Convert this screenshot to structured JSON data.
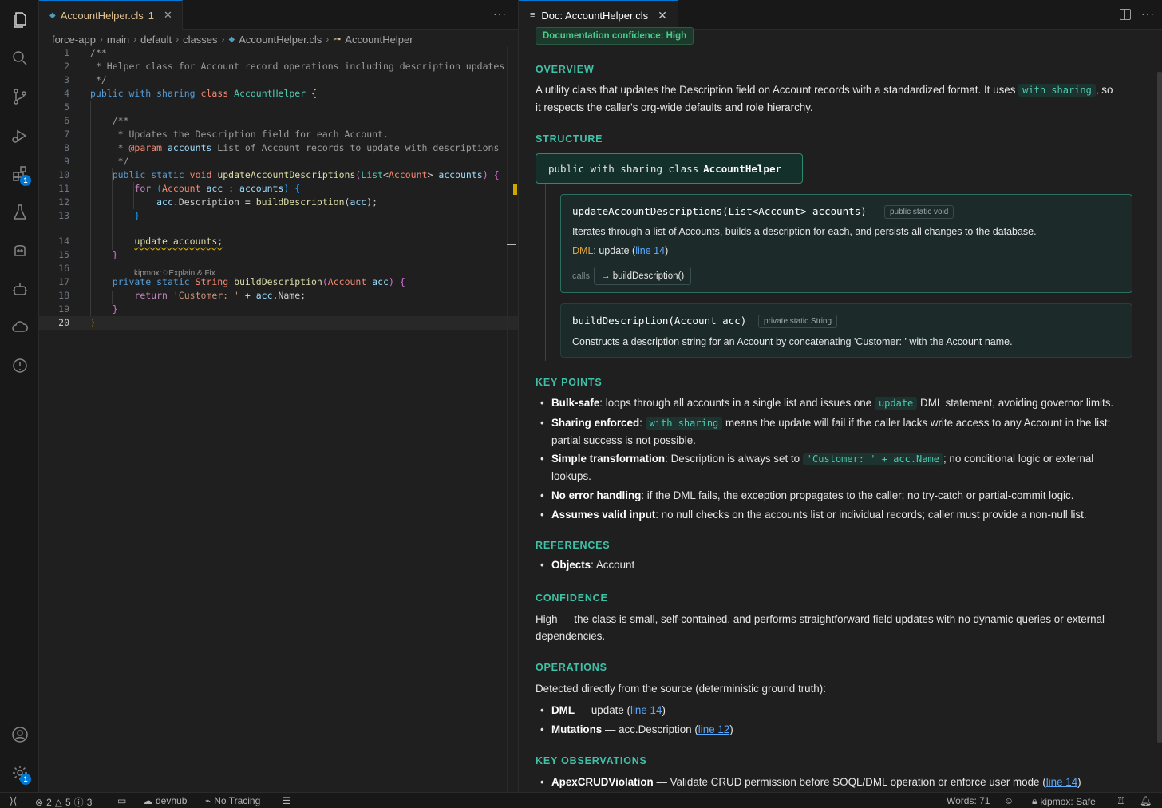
{
  "editor": {
    "tab": {
      "name": "AccountHelper.cls",
      "problems": "1"
    },
    "breadcrumb": [
      "force-app",
      "main",
      "default",
      "classes",
      "AccountHelper.cls",
      "AccountHelper"
    ],
    "lens_text": "kipmox:",
    "lens_action": "Explain & Fix",
    "line_numbers": [
      "1",
      "2",
      "3",
      "4",
      "5",
      "6",
      "7",
      "8",
      "9",
      "10",
      "11",
      "12",
      "13",
      "14",
      "15",
      "16",
      "17",
      "18",
      "19",
      "20"
    ]
  },
  "doc": {
    "tab_title": "Doc: AccountHelper.cls",
    "confidence_badge": "Documentation confidence: High",
    "overview": {
      "heading": "OVERVIEW",
      "text1": "A utility class that updates the Description field on Account records with a standardized format. It uses",
      "code": "with sharing",
      "text2": ", so",
      "text3": "it respects the caller's org-wide defaults and role hierarchy."
    },
    "structure": {
      "heading": "STRUCTURE",
      "class_prefix": "public with sharing class",
      "class_name": "AccountHelper",
      "methods": [
        {
          "signature": "updateAccountDescriptions(List<Account> accounts)",
          "tag": "public static void",
          "description": "Iterates through a list of Accounts, builds a description for each, and persists all changes to the database.",
          "dml_label": "DML",
          "dml_op": ": update (",
          "dml_link": "line 14",
          "dml_close": ")",
          "calls_label": "calls",
          "calls": "→ buildDescription()"
        },
        {
          "signature": "buildDescription(Account acc)",
          "tag": "private static String",
          "description": "Constructs a description string for an Account by concatenating 'Customer: ' with the Account name."
        }
      ]
    },
    "key_points": {
      "heading": "KEY POINTS",
      "items": [
        {
          "bold": "Bulk-safe",
          "pre": ": loops through all accounts in a single list and issues one ",
          "code": "update",
          "post": " DML statement, avoiding governor limits."
        },
        {
          "bold": "Sharing enforced",
          "pre": ": ",
          "code": "with sharing",
          "post": " means the update will fail if the caller lacks write access to any Account in the list; partial success is not possible."
        },
        {
          "bold": "Simple transformation",
          "pre": ": Description is always set to ",
          "code": "'Customer: ' + acc.Name",
          "post": "; no conditional logic or external lookups."
        },
        {
          "bold": "No error handling",
          "pre": ": if the DML fails, the exception propagates to the caller; no try-catch or partial-commit logic.",
          "code": "",
          "post": ""
        },
        {
          "bold": "Assumes valid input",
          "pre": ": no null checks on the accounts list or individual records; caller must provide a non-null list.",
          "code": "",
          "post": ""
        }
      ]
    },
    "references": {
      "heading": "REFERENCES",
      "label": "Objects",
      "value": ": Account"
    },
    "confidence": {
      "heading": "CONFIDENCE",
      "text": "High — the class is small, self-contained, and performs straightforward field updates with no dynamic queries or external dependencies."
    },
    "operations": {
      "heading": "OPERATIONS",
      "intro": "Detected directly from the source (deterministic ground truth):",
      "items": [
        {
          "bold": "DML",
          "text": " — update (",
          "link": "line 14",
          "close": ")"
        },
        {
          "bold": "Mutations",
          "text": " — acc.Description (",
          "link": "line 12",
          "close": ")"
        }
      ]
    },
    "observations": {
      "heading": "KEY OBSERVATIONS",
      "items": [
        {
          "bold": "ApexCRUDViolation",
          "text": " — Validate CRUD permission before SOQL/DML operation or enforce user mode (",
          "link": "line 14",
          "close": ")"
        }
      ]
    }
  },
  "status": {
    "errors": "2",
    "warnings": "5",
    "infos": "3",
    "org": "devhub",
    "tracing": "No Tracing",
    "words": "Words: 71",
    "kipmox": "kipmox: Safe"
  },
  "activity": {
    "extensions_badge": "1",
    "settings_badge": "1"
  }
}
